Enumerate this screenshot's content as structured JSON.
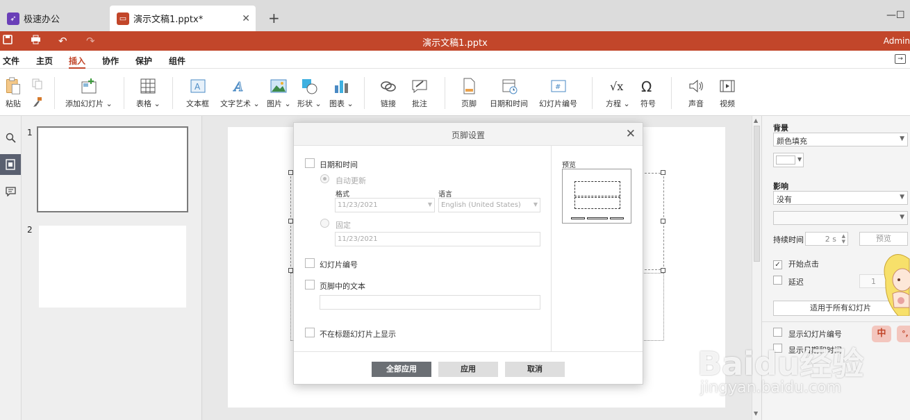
{
  "colors": {
    "accent": "#c2462a",
    "tab_active": "#ffffff",
    "dialog_primary": "#6b6f74"
  },
  "tabs": [
    {
      "label": "极速办公",
      "icon": "rocket-icon"
    },
    {
      "label": "演示文稿1.pptx*",
      "icon": "presentation-icon"
    }
  ],
  "window": {
    "minimize": "—",
    "maximize": "☐"
  },
  "titlebar": {
    "title": "演示文稿1.pptx",
    "user": "Admin"
  },
  "menu": [
    "文件",
    "主页",
    "插入",
    "协作",
    "保护",
    "组件"
  ],
  "menu_active": "插入",
  "ribbon": {
    "paste": "粘贴",
    "add_slide": "添加幻灯片",
    "table": "表格",
    "textbox": "文本框",
    "wordart": "文字艺术",
    "image": "图片",
    "shape": "形状",
    "chart": "图表",
    "link": "链接",
    "comment": "批注",
    "footer": "页脚",
    "datetime": "日期和时间",
    "slide_number": "幻灯片编号",
    "equation": "方程",
    "symbol": "符号",
    "audio": "声音",
    "video": "视频"
  },
  "thumbnails": [
    {
      "num": "1"
    },
    {
      "num": "2"
    }
  ],
  "right_panel": {
    "background_label": "背景",
    "background_value": "颜色填充",
    "effect_label": "影响",
    "effect_value": "没有",
    "effect_sub": "",
    "duration_label": "持续时间",
    "duration_value": "2 s",
    "preview_button": "预览",
    "start_on_click": "开始点击",
    "delay": "延迟",
    "delay_value": "1",
    "apply_all": "适用于所有幻灯片",
    "show_slide_number": "显示幻灯片编号",
    "show_datetime": "显示日期和时间"
  },
  "dialog": {
    "title": "页脚设置",
    "datetime_label": "日期和时间",
    "auto_update": "自动更新",
    "format_label": "格式",
    "format_value": "11/23/2021",
    "language_label": "语言",
    "language_value": "English (United States)",
    "fixed_label": "固定",
    "fixed_value": "11/23/2021",
    "slide_number_label": "幻灯片编号",
    "footer_text_label": "页脚中的文本",
    "footer_text_value": "",
    "hide_on_title_label": "不在标题幻灯片上显示",
    "preview_label": "预览",
    "buttons": {
      "apply_all": "全部应用",
      "apply": "应用",
      "cancel": "取消"
    }
  },
  "ime": {
    "zh": "中",
    "dot": "°,"
  },
  "watermark": {
    "brand": "Baidu经验",
    "url": "jingyan.baidu.com"
  }
}
